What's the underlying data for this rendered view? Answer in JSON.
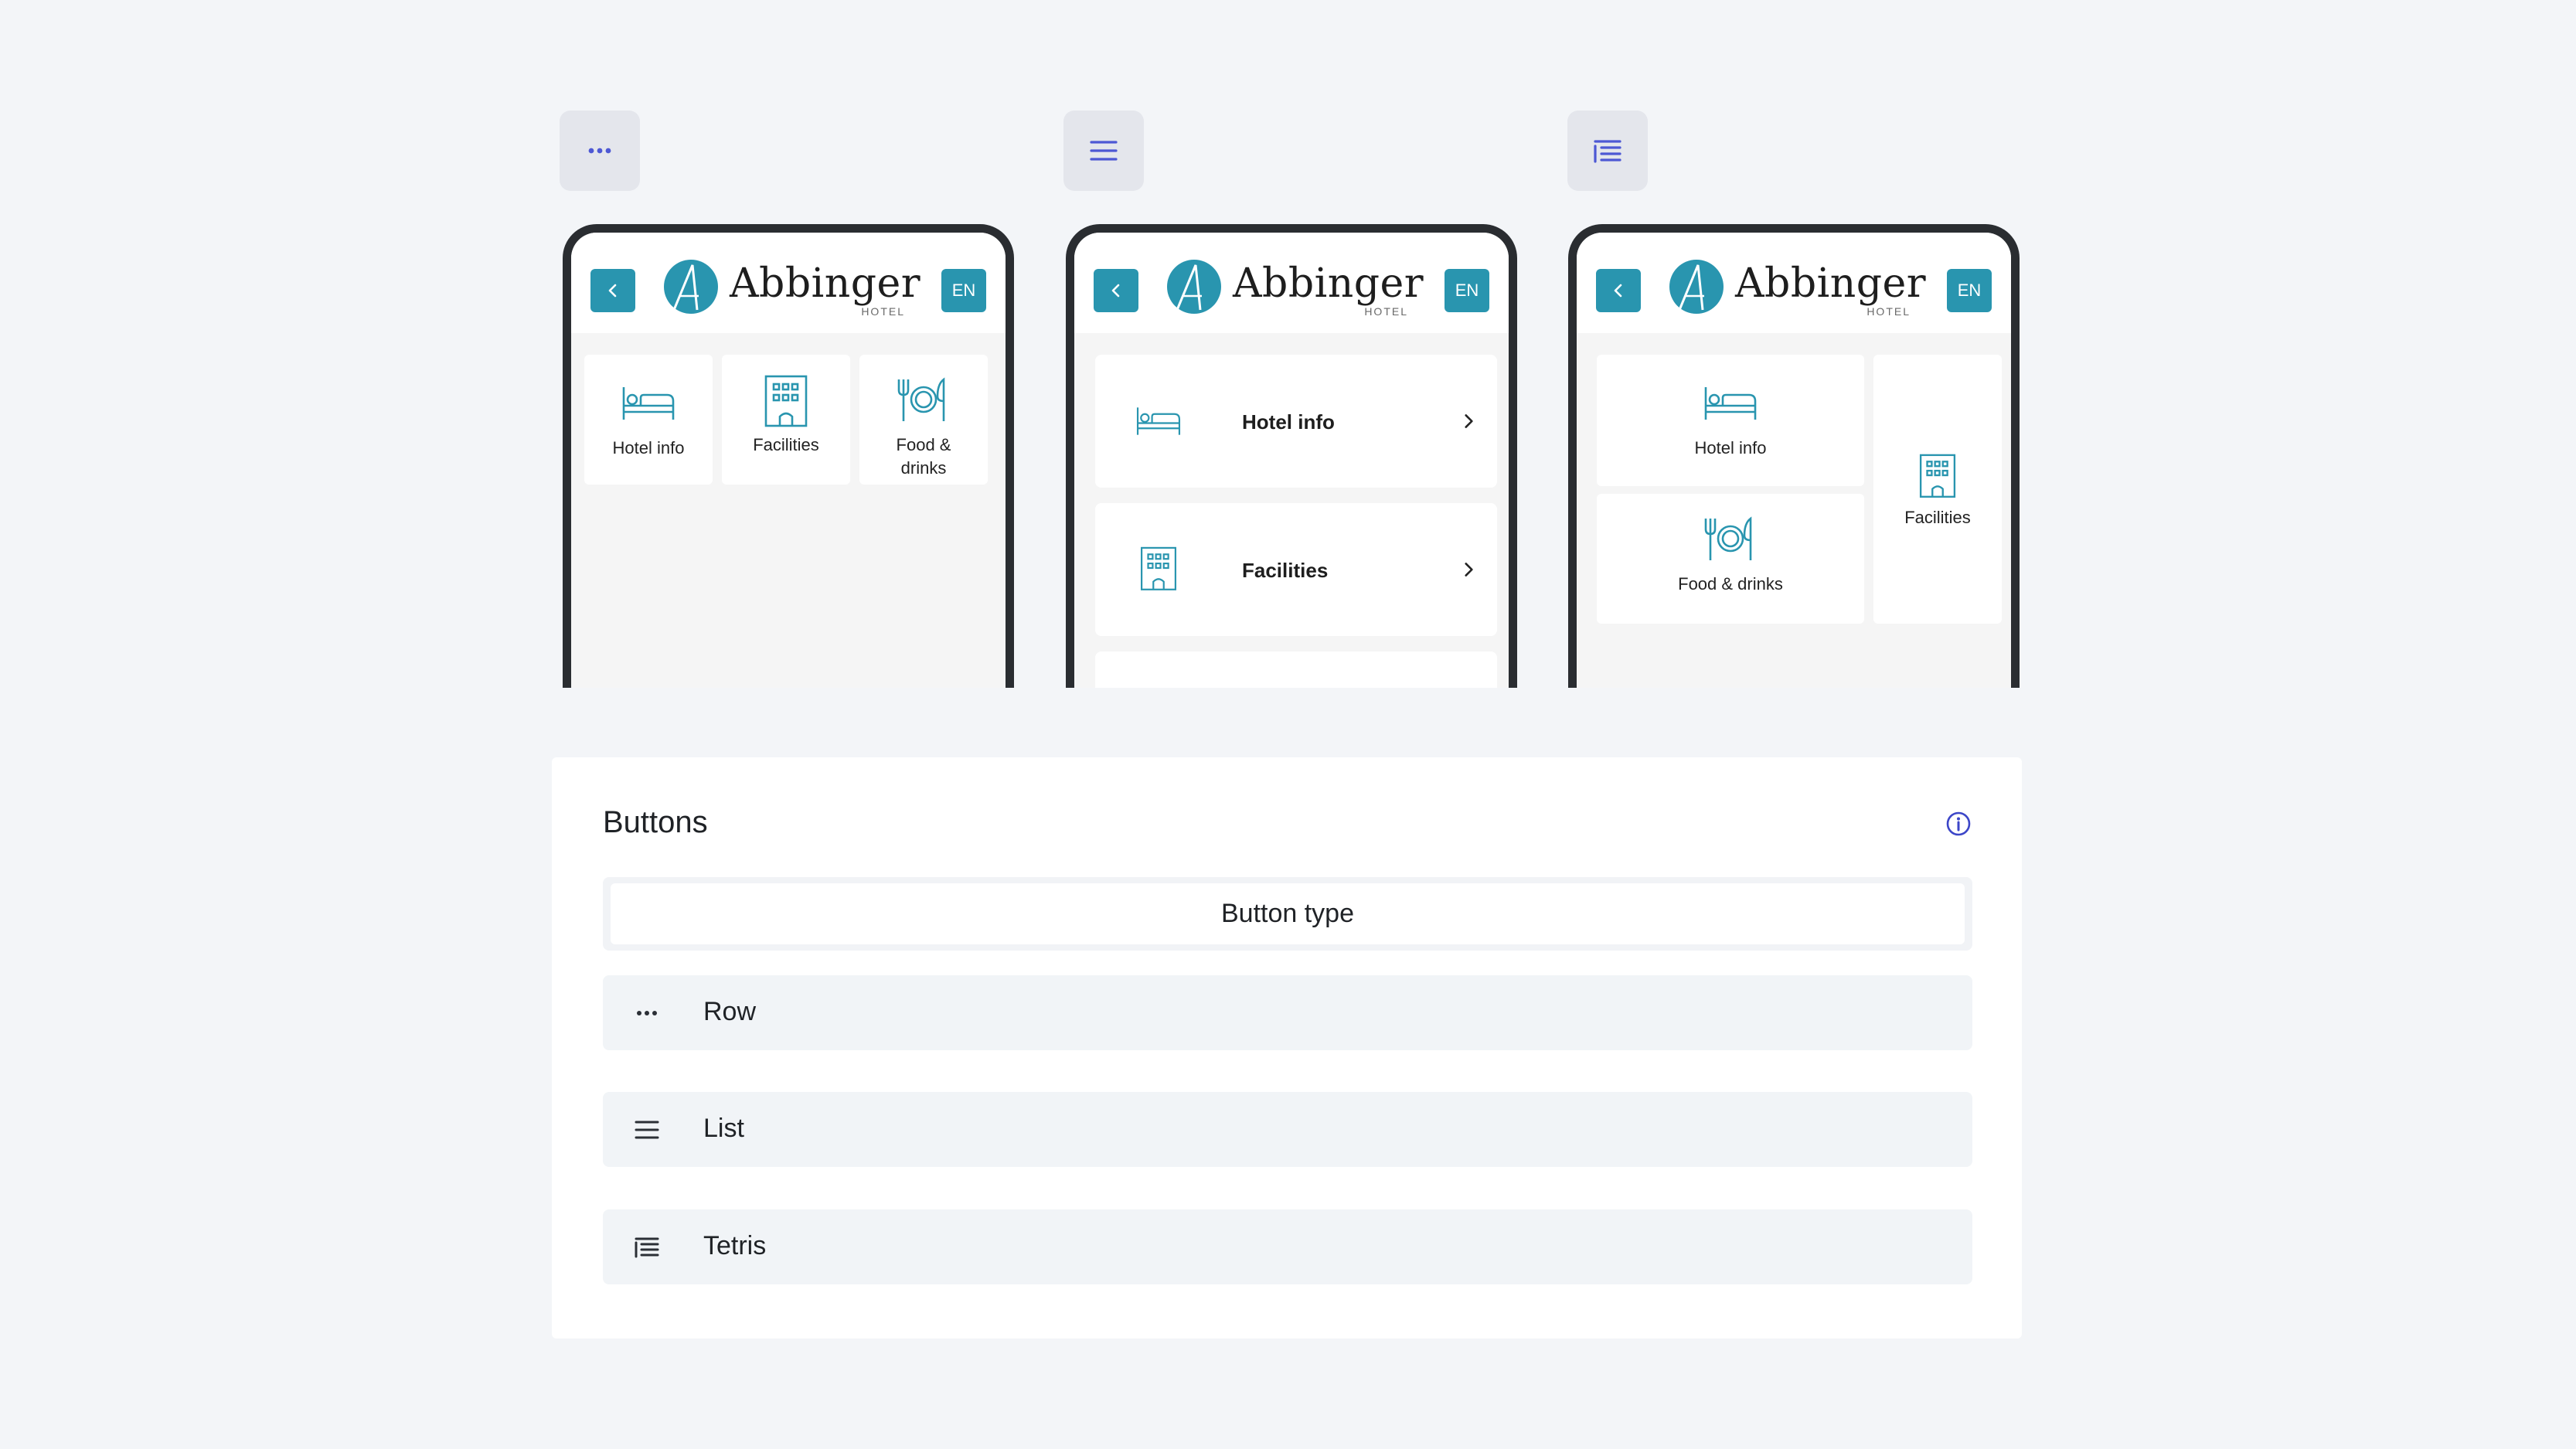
{
  "colors": {
    "accent": "#2995af",
    "toggle_icon": "#4d58d4",
    "page_background": "#f3f5f8",
    "phone_frame": "#2a2d31"
  },
  "toggles": [
    {
      "icon": "dots-icon"
    },
    {
      "icon": "list-icon"
    },
    {
      "icon": "tetris-icon"
    }
  ],
  "phone": {
    "brand_name": "Abbinger",
    "brand_sub": "HOTEL",
    "lang": "EN"
  },
  "row_layout": {
    "tiles": [
      "Hotel info",
      "Facilities",
      "Food &\ndrinks"
    ]
  },
  "list_layout": {
    "rows": [
      "Hotel info",
      "Facilities"
    ]
  },
  "tetris_layout": {
    "tiles": [
      "Hotel info",
      "Facilities",
      "Food & drinks"
    ]
  },
  "panel": {
    "title": "Buttons",
    "type_header": "Button type",
    "options": [
      {
        "label": "Row",
        "icon": "dots-icon"
      },
      {
        "label": "List",
        "icon": "list-icon"
      },
      {
        "label": "Tetris",
        "icon": "tetris-icon"
      }
    ]
  }
}
